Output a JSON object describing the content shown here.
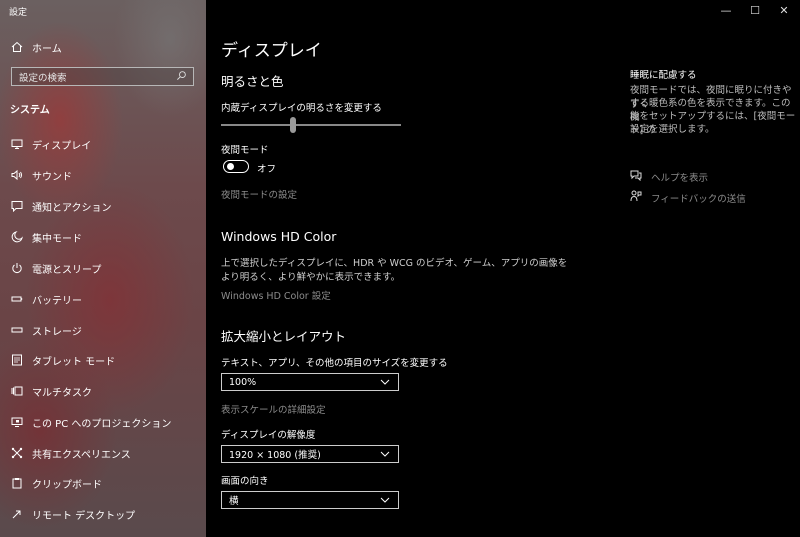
{
  "window": {
    "title": "設定",
    "minimize_glyph": "—",
    "maximize_glyph": "☐",
    "close_glyph": "✕"
  },
  "sidebar": {
    "home_label": "ホーム",
    "search_placeholder": "設定の検索",
    "section_label": "システム",
    "items": [
      {
        "label": "ディスプレイ",
        "icon": "monitor-icon"
      },
      {
        "label": "サウンド",
        "icon": "speaker-icon"
      },
      {
        "label": "通知とアクション",
        "icon": "notification-icon"
      },
      {
        "label": "集中モード",
        "icon": "moon-icon"
      },
      {
        "label": "電源とスリープ",
        "icon": "power-icon"
      },
      {
        "label": "バッテリー",
        "icon": "battery-icon"
      },
      {
        "label": "ストレージ",
        "icon": "storage-icon"
      },
      {
        "label": "タブレット モード",
        "icon": "tablet-icon"
      },
      {
        "label": "マルチタスク",
        "icon": "multitask-icon"
      },
      {
        "label": "この PC へのプロジェクション",
        "icon": "projection-icon"
      },
      {
        "label": "共有エクスペリエンス",
        "icon": "shared-experience-icon"
      },
      {
        "label": "クリップボード",
        "icon": "clipboard-icon"
      },
      {
        "label": "リモート デスクトップ",
        "icon": "remote-desktop-icon"
      }
    ]
  },
  "main": {
    "page_title": "ディスプレイ",
    "brightness_section": {
      "heading": "明るさと色",
      "slider_label": "内蔵ディスプレイの明るさを変更する",
      "brightness_fraction": 0.4,
      "night_light_label": "夜間モード",
      "night_light_state": "オフ",
      "night_light_settings_link": "夜間モードの設定"
    },
    "hdr_section": {
      "heading": "Windows HD Color",
      "description_line1": "上で選択したディスプレイに、HDR や WCG のビデオ、ゲーム、アプリの画像を",
      "description_line2": "より明るく、より鮮やかに表示できます。",
      "settings_link": "Windows HD Color 設定"
    },
    "scale_section": {
      "heading": "拡大縮小とレイアウト",
      "scale_label": "テキスト、アプリ、その他の項目のサイズを変更する",
      "scale_value": "100%",
      "advanced_scale_link": "表示スケールの詳細設定",
      "resolution_label": "ディスプレイの解像度",
      "resolution_value": "1920 × 1080 (推奨)",
      "orientation_label": "画面の向き",
      "orientation_value": "横"
    }
  },
  "right_panel": {
    "heading": "睡眠に配慮する",
    "description_lines": [
      "夜間モードでは、夜間に眠りに付きやすく",
      "する暖色系の色を表示できます。この機",
      "能をセットアップするには、[夜間モード] の",
      "設定を選択します。"
    ],
    "help_link": "ヘルプを表示",
    "feedback_link": "フィードバックの送信"
  }
}
